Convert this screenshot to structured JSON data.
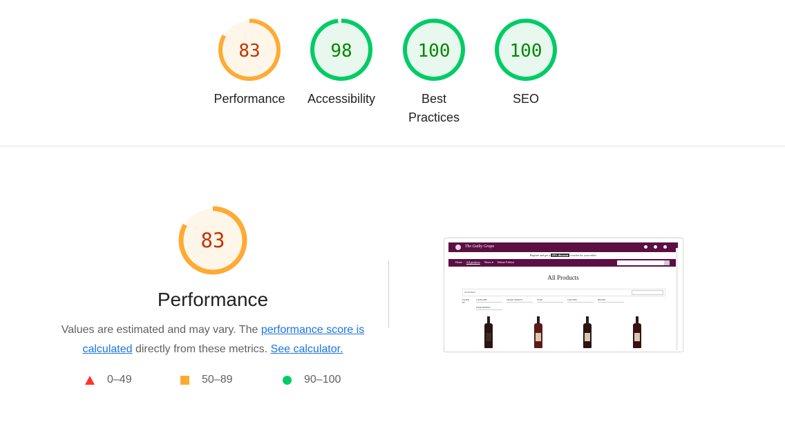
{
  "summary": {
    "categories": [
      {
        "label": "Performance",
        "score": "83",
        "fraction": 0.83,
        "color": "#fa3",
        "fill": "#fff6ea",
        "text_color": "#c33300"
      },
      {
        "label": "Accessibility",
        "score": "98",
        "fraction": 0.98,
        "color": "#0c6",
        "fill": "#e8f8ee",
        "text_color": "#008800"
      },
      {
        "label": "Best Practices",
        "score": "100",
        "fraction": 1.0,
        "color": "#0c6",
        "fill": "#e8f8ee",
        "text_color": "#008800"
      },
      {
        "label": "SEO",
        "score": "100",
        "fraction": 1.0,
        "color": "#0c6",
        "fill": "#e8f8ee",
        "text_color": "#008800"
      }
    ]
  },
  "performance": {
    "score": "83",
    "fraction": 0.83,
    "title": "Performance",
    "desc_prefix": "Values are estimated and may vary. The ",
    "link_score": "performance score is calculated",
    "desc_middle": " directly from these metrics. ",
    "link_calculator": "See calculator."
  },
  "legend": {
    "fail": "0–49",
    "average": "50–89",
    "pass": "90–100",
    "fail_color": "#f33",
    "average_color": "#fa3",
    "pass_color": "#0c6"
  },
  "screenshot": {
    "brand": "The Guilty Grape",
    "promo_prefix": "Register and get a",
    "promo_highlight": "10% discount",
    "promo_suffix": "voucher for your orders",
    "nav": [
      "Home",
      "All products",
      "Wines ▾",
      "Deluxe Edition"
    ],
    "heading": "All Products",
    "count_label": "192 Products",
    "filter_label": "FILTER BY",
    "filters_row1": [
      "CATEGORY",
      "GRAPE VARIETY",
      "YEAR",
      "COUNTRY",
      "REGION"
    ],
    "filters_row2": [
      "FOOD PAIRING"
    ]
  }
}
